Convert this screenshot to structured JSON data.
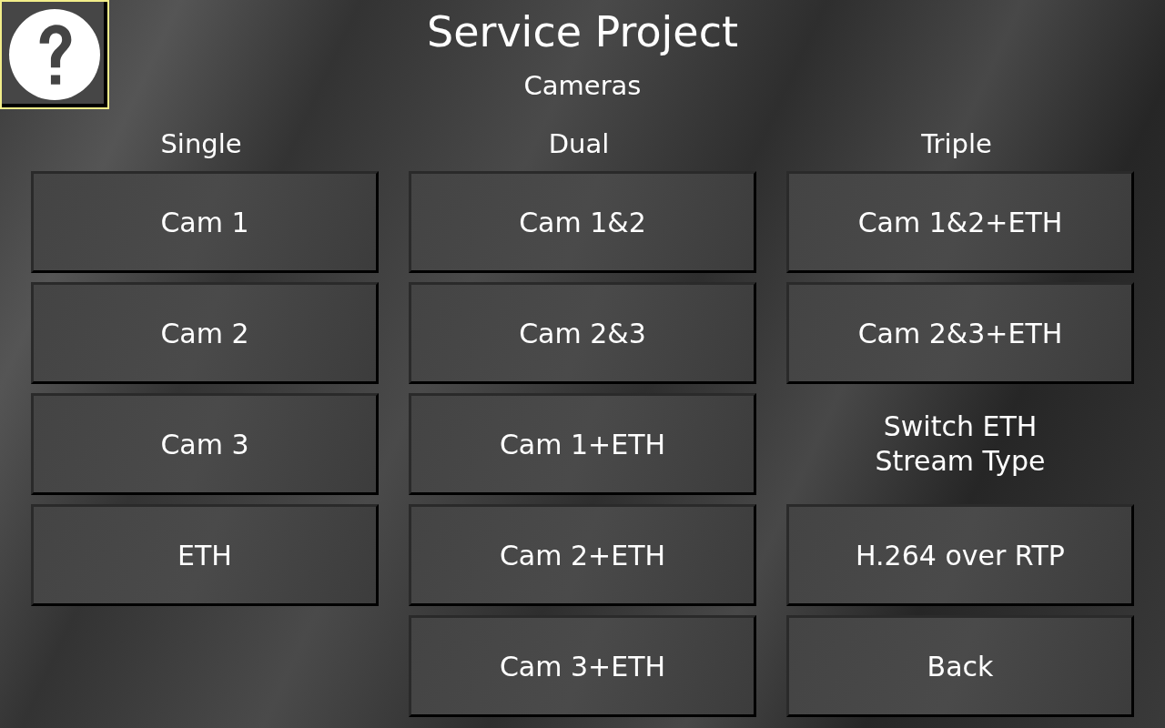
{
  "title": "Service Project",
  "subtitle": "Cameras",
  "columns": [
    {
      "heading": "Single",
      "items": [
        {
          "kind": "button",
          "label": "Cam 1"
        },
        {
          "kind": "button",
          "label": "Cam 2"
        },
        {
          "kind": "button",
          "label": "Cam 3"
        },
        {
          "kind": "button",
          "label": "ETH"
        }
      ]
    },
    {
      "heading": "Dual",
      "items": [
        {
          "kind": "button",
          "label": "Cam 1&2"
        },
        {
          "kind": "button",
          "label": "Cam 2&3"
        },
        {
          "kind": "button",
          "label": "Cam 1+ETH"
        },
        {
          "kind": "button",
          "label": "Cam 2+ETH"
        },
        {
          "kind": "button",
          "label": "Cam 3+ETH"
        }
      ]
    },
    {
      "heading": "Triple",
      "items": [
        {
          "kind": "button",
          "label": "Cam 1&2+ETH"
        },
        {
          "kind": "button",
          "label": "Cam 2&3+ETH"
        },
        {
          "kind": "label",
          "label": "Switch ETH Stream Type"
        },
        {
          "kind": "button",
          "label": "H.264 over RTP"
        },
        {
          "kind": "button",
          "label": "Back"
        }
      ]
    }
  ]
}
